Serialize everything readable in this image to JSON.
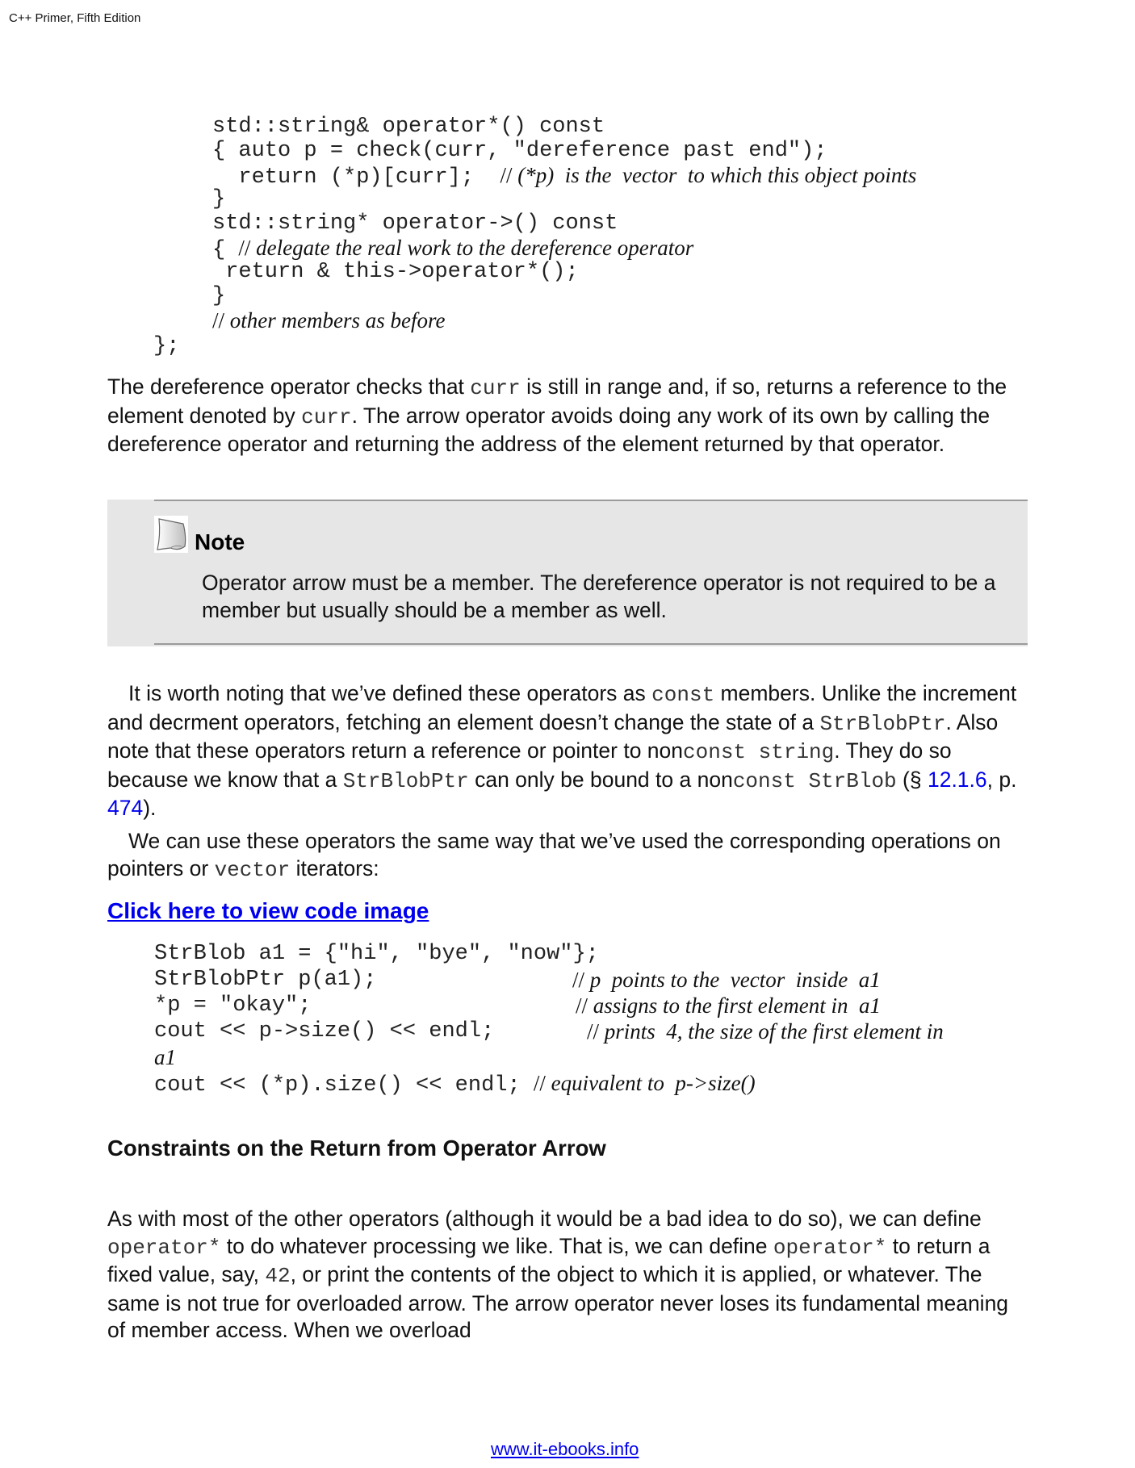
{
  "header": {
    "title": "C++ Primer, Fifth Edition"
  },
  "code_block_1": {
    "lines": [
      {
        "code": "std::string& operator*() const",
        "comment": ""
      },
      {
        "code": "{ auto p = check(curr, \"dereference past end\");",
        "comment": ""
      },
      {
        "code": "  return (*p)[curr];  ",
        "comment_slash": "//",
        "comment": " (*p)  is the  vector  to which this object points"
      },
      {
        "code": "}",
        "comment": ""
      },
      {
        "code": "std::string* operator->() const",
        "comment": ""
      },
      {
        "code": "{ ",
        "comment_slash": "//",
        "comment": " delegate the real work to the dereference operator"
      },
      {
        "code": " return & this->operator*();",
        "comment": ""
      },
      {
        "code": "}",
        "comment": ""
      },
      {
        "code": "",
        "comment_slash": "//",
        "comment": " other members as before"
      },
      {
        "code": "};",
        "comment": ""
      }
    ]
  },
  "paragraph_1": {
    "segments": [
      {
        "text": "The dereference operator checks that ",
        "mono": false
      },
      {
        "text": "curr",
        "mono": true
      },
      {
        "text": " is still in range and, if so, returns a reference to the element denoted by ",
        "mono": false
      },
      {
        "text": "curr",
        "mono": true
      },
      {
        "text": ". The arrow operator avoids doing any work of its own by calling the dereference operator and returning the address of the element returned by that operator.",
        "mono": false
      }
    ]
  },
  "note": {
    "title": "Note",
    "icon": "note-page-icon",
    "text": "Operator arrow must be a member. The dereference operator is not required to be a member but usually should be a member as well."
  },
  "paragraph_2": {
    "segments": [
      {
        "text": "It is worth noting that we’ve defined these operators as ",
        "mono": false
      },
      {
        "text": "const",
        "mono": true
      },
      {
        "text": " members. Unlike the increment and decrment operators, fetching an element doesn’t change the state of a ",
        "mono": false
      },
      {
        "text": "StrBlobPtr",
        "mono": true
      },
      {
        "text": ". Also note that these operators return a reference or pointer to non",
        "mono": false
      },
      {
        "text": "const string",
        "mono": true
      },
      {
        "text": ". They do so because we know that a ",
        "mono": false
      },
      {
        "text": "StrBlobPtr",
        "mono": true
      },
      {
        "text": " can only be bound to a non",
        "mono": false
      },
      {
        "text": "const StrBlob",
        "mono": true
      },
      {
        "text": " (§ ",
        "mono": false
      },
      {
        "text": "12.1.6",
        "link": true
      },
      {
        "text": ", p. ",
        "mono": false
      },
      {
        "text": "474",
        "link": true
      },
      {
        "text": ").",
        "mono": false
      }
    ]
  },
  "paragraph_3": {
    "segments": [
      {
        "text": "We can use these operators the same way that we’ve used the corresponding operations on pointers or ",
        "mono": false
      },
      {
        "text": "vector",
        "mono": true
      },
      {
        "text": " iterators:",
        "mono": false
      }
    ]
  },
  "code_image_link": "Click here to view code image",
  "code_block_2": {
    "lines": [
      {
        "code": "StrBlob a1 = {\"hi\", \"bye\", \"now\"};",
        "comment": ""
      },
      {
        "code": "StrBlobPtr p(a1);",
        "comment_slash": "//",
        "comment": " p  points to the  vector  inside  a1"
      },
      {
        "code": "*p = \"okay\";",
        "comment_slash": "//",
        "comment": " assigns to the first element in  a1"
      },
      {
        "code": "cout << p->size() << endl;",
        "comment_slash": "//",
        "comment": " prints  4, the size of the first element in"
      },
      {
        "code": "",
        "comment": "a1"
      },
      {
        "code": "cout << (*p).size() << endl; ",
        "comment_slash": "//",
        "comment": " equivalent to  p->size()"
      }
    ]
  },
  "section_heading": "Constraints on the Return from Operator Arrow",
  "paragraph_4": {
    "segments": [
      {
        "text": "As with most of the other operators (although it would be a bad idea to do so), we can define ",
        "mono": false
      },
      {
        "text": "operator*",
        "mono": true
      },
      {
        "text": " to do whatever processing we like. That is, we can define ",
        "mono": false
      },
      {
        "text": "operator*",
        "mono": true
      },
      {
        "text": " to return a fixed value, say, ",
        "mono": false
      },
      {
        "text": "42",
        "mono": true
      },
      {
        "text": ", or print the contents of the object to which it is applied, or whatever. The same is not true for overloaded arrow. The arrow operator never loses its fundamental meaning of member access. When we overload",
        "mono": false
      }
    ]
  },
  "footer": {
    "link": "www.it-ebooks.info"
  },
  "colors": {
    "link": "#0000ee",
    "note_background": "#e6e6e6",
    "note_rule": "#9a9a9a"
  }
}
